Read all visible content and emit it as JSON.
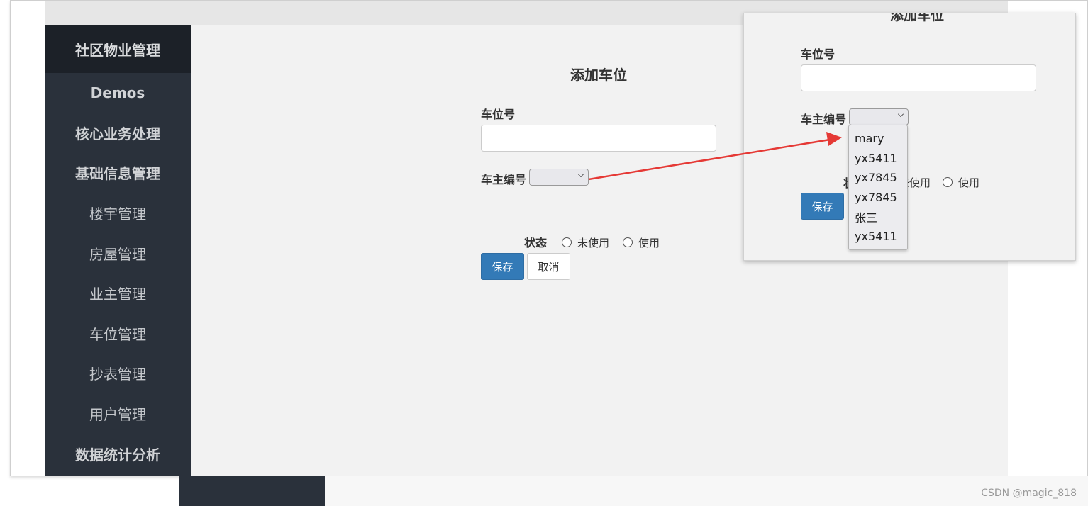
{
  "sidebar": {
    "title": "社区物业管理",
    "items": [
      {
        "label": "Demos",
        "bold": true
      },
      {
        "label": "核心业务处理",
        "bold": true
      },
      {
        "label": "基础信息管理",
        "bold": true
      },
      {
        "label": "楼宇管理",
        "bold": false
      },
      {
        "label": "房屋管理",
        "bold": false
      },
      {
        "label": "业主管理",
        "bold": false
      },
      {
        "label": "车位管理",
        "bold": false
      },
      {
        "label": "抄表管理",
        "bold": false
      },
      {
        "label": "用户管理",
        "bold": false
      },
      {
        "label": "数据统计分析",
        "bold": true
      }
    ]
  },
  "form": {
    "title": "添加车位",
    "spot_label": "车位号",
    "spot_value": "",
    "owner_label": "车主编号",
    "owner_value": "",
    "status_label": "状态",
    "status_options": [
      "未使用",
      "使用"
    ],
    "save_label": "保存",
    "cancel_label": "取消"
  },
  "callout": {
    "title": "添加车位",
    "spot_label": "车位号",
    "owner_label": "车主编号",
    "status_label_partial": "状",
    "status_option_partial": "未使用",
    "status_option_2": "使用",
    "save_label": "保存",
    "dropdown_options": [
      "mary",
      "yx5411",
      "yx7845",
      "yx7845",
      "张三",
      "yx5411"
    ]
  },
  "watermark": "CSDN @magic_818",
  "colors": {
    "sidebar_bg": "#2a313b",
    "primary": "#337ab7",
    "arrow": "#e53935"
  }
}
